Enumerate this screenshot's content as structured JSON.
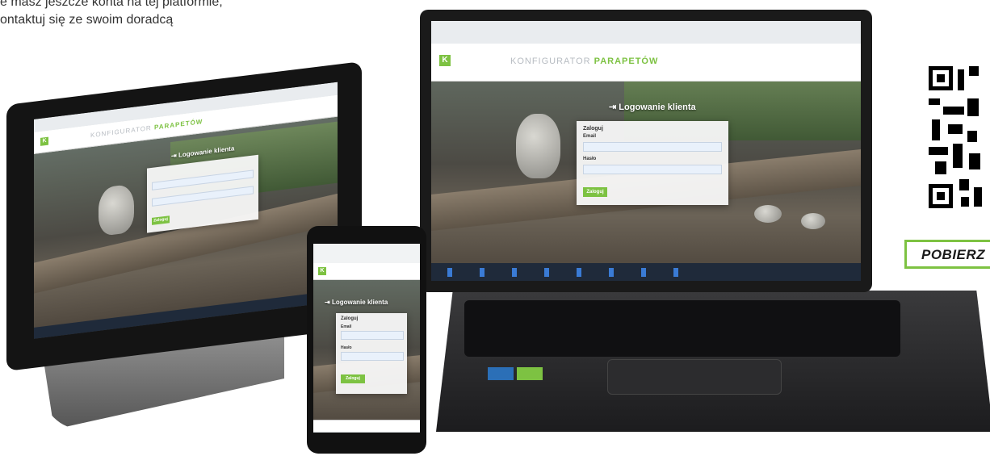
{
  "intro": {
    "line1": "e masz jeszcze konta na tej platformie,",
    "line2": "ontaktuj się ze swoim doradcą"
  },
  "app": {
    "brand_letter": "K",
    "title_prefix": "KONFIGURATOR",
    "title_accent": "PARAPETÓW",
    "login_heading": "Logowanie klienta",
    "panel_heading": "Zaloguj",
    "email_label": "Email",
    "password_label": "Hasło",
    "login_button": "Zaloguj",
    "accent_color": "#7dc242"
  },
  "qr": {
    "download_label": "POBIERZ"
  }
}
